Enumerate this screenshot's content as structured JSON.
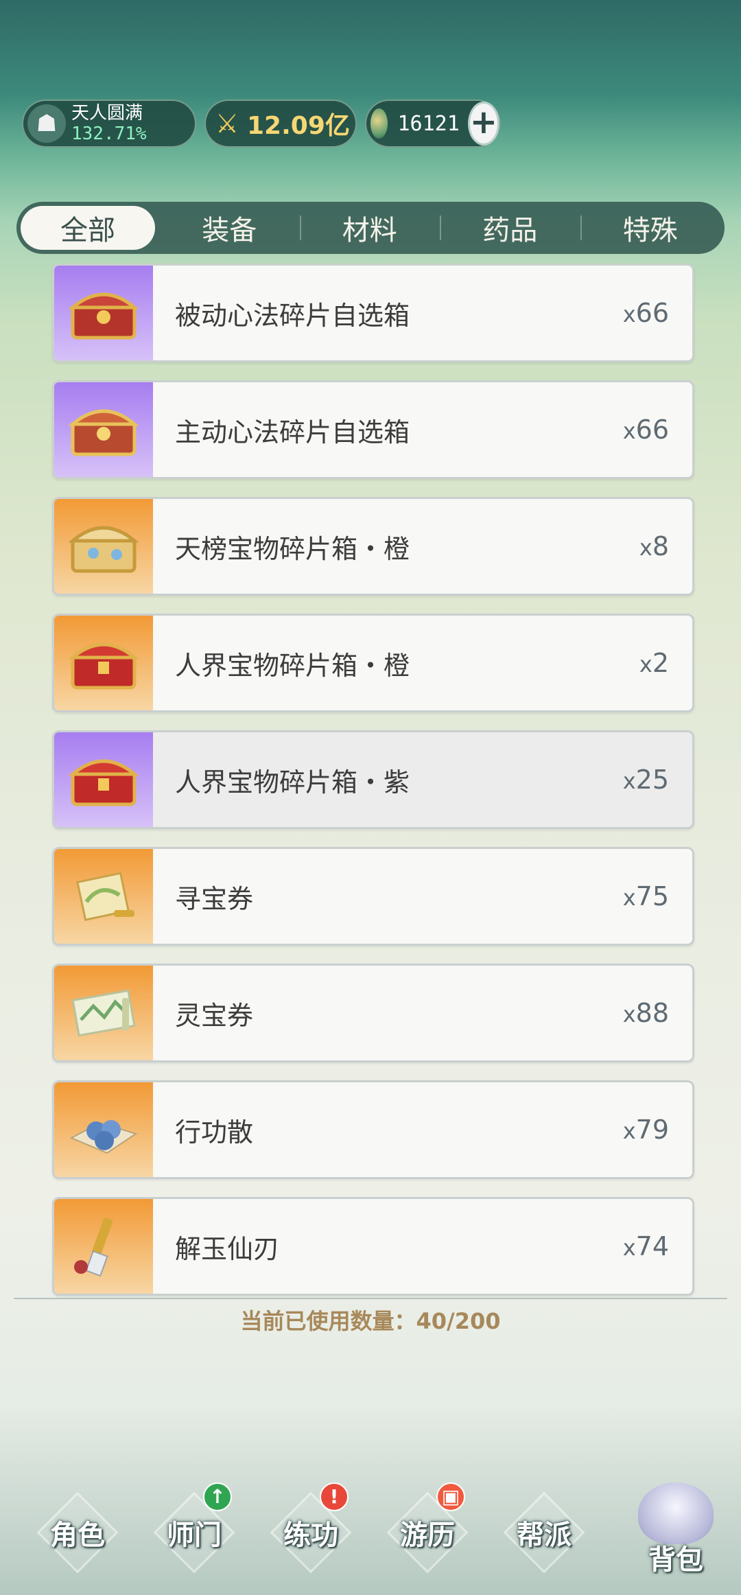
{
  "header": {
    "realm_name": "天人圆满",
    "realm_percent": "132.71%",
    "power": "12.09亿",
    "coins": "16121",
    "plus_icon": "plus-icon"
  },
  "tabs": [
    "全部",
    "装备",
    "材料",
    "药品",
    "特殊"
  ],
  "items": [
    {
      "name": "被动心法碎片自选箱",
      "count": "66",
      "rarity": "purple",
      "icon": "treasure-chest-red-gold-icon"
    },
    {
      "name": "主动心法碎片自选箱",
      "count": "66",
      "rarity": "purple",
      "icon": "treasure-chest-gold-icon"
    },
    {
      "name": "天榜宝物碎片箱・橙",
      "count": "8",
      "rarity": "orange",
      "icon": "treasure-chest-gold-blue-icon"
    },
    {
      "name": "人界宝物碎片箱・橙",
      "count": "2",
      "rarity": "orange",
      "icon": "treasure-chest-red-icon"
    },
    {
      "name": "人界宝物碎片箱・紫",
      "count": "25",
      "rarity": "purple",
      "icon": "treasure-chest-red-icon"
    },
    {
      "name": "寻宝券",
      "count": "75",
      "rarity": "orange",
      "icon": "scroll-icon"
    },
    {
      "name": "灵宝券",
      "count": "88",
      "rarity": "orange",
      "icon": "scroll-map-icon"
    },
    {
      "name": "行功散",
      "count": "79",
      "rarity": "orange",
      "icon": "pill-balls-icon"
    },
    {
      "name": "解玉仙刃",
      "count": "74",
      "rarity": "orange",
      "icon": "blade-icon"
    }
  ],
  "count_prefix": "x",
  "usage": "当前已使用数量：40/200",
  "nav": [
    {
      "label": "角色",
      "badge": ""
    },
    {
      "label": "师门",
      "badge": "↑"
    },
    {
      "label": "练功",
      "badge": "!"
    },
    {
      "label": "游历",
      "badge": "▣"
    },
    {
      "label": "帮派",
      "badge": ""
    },
    {
      "label": "背包",
      "badge": ""
    }
  ],
  "colors": {
    "purple": "#a77ef0",
    "orange": "#f29a36",
    "usage_text": "#a8885a"
  }
}
